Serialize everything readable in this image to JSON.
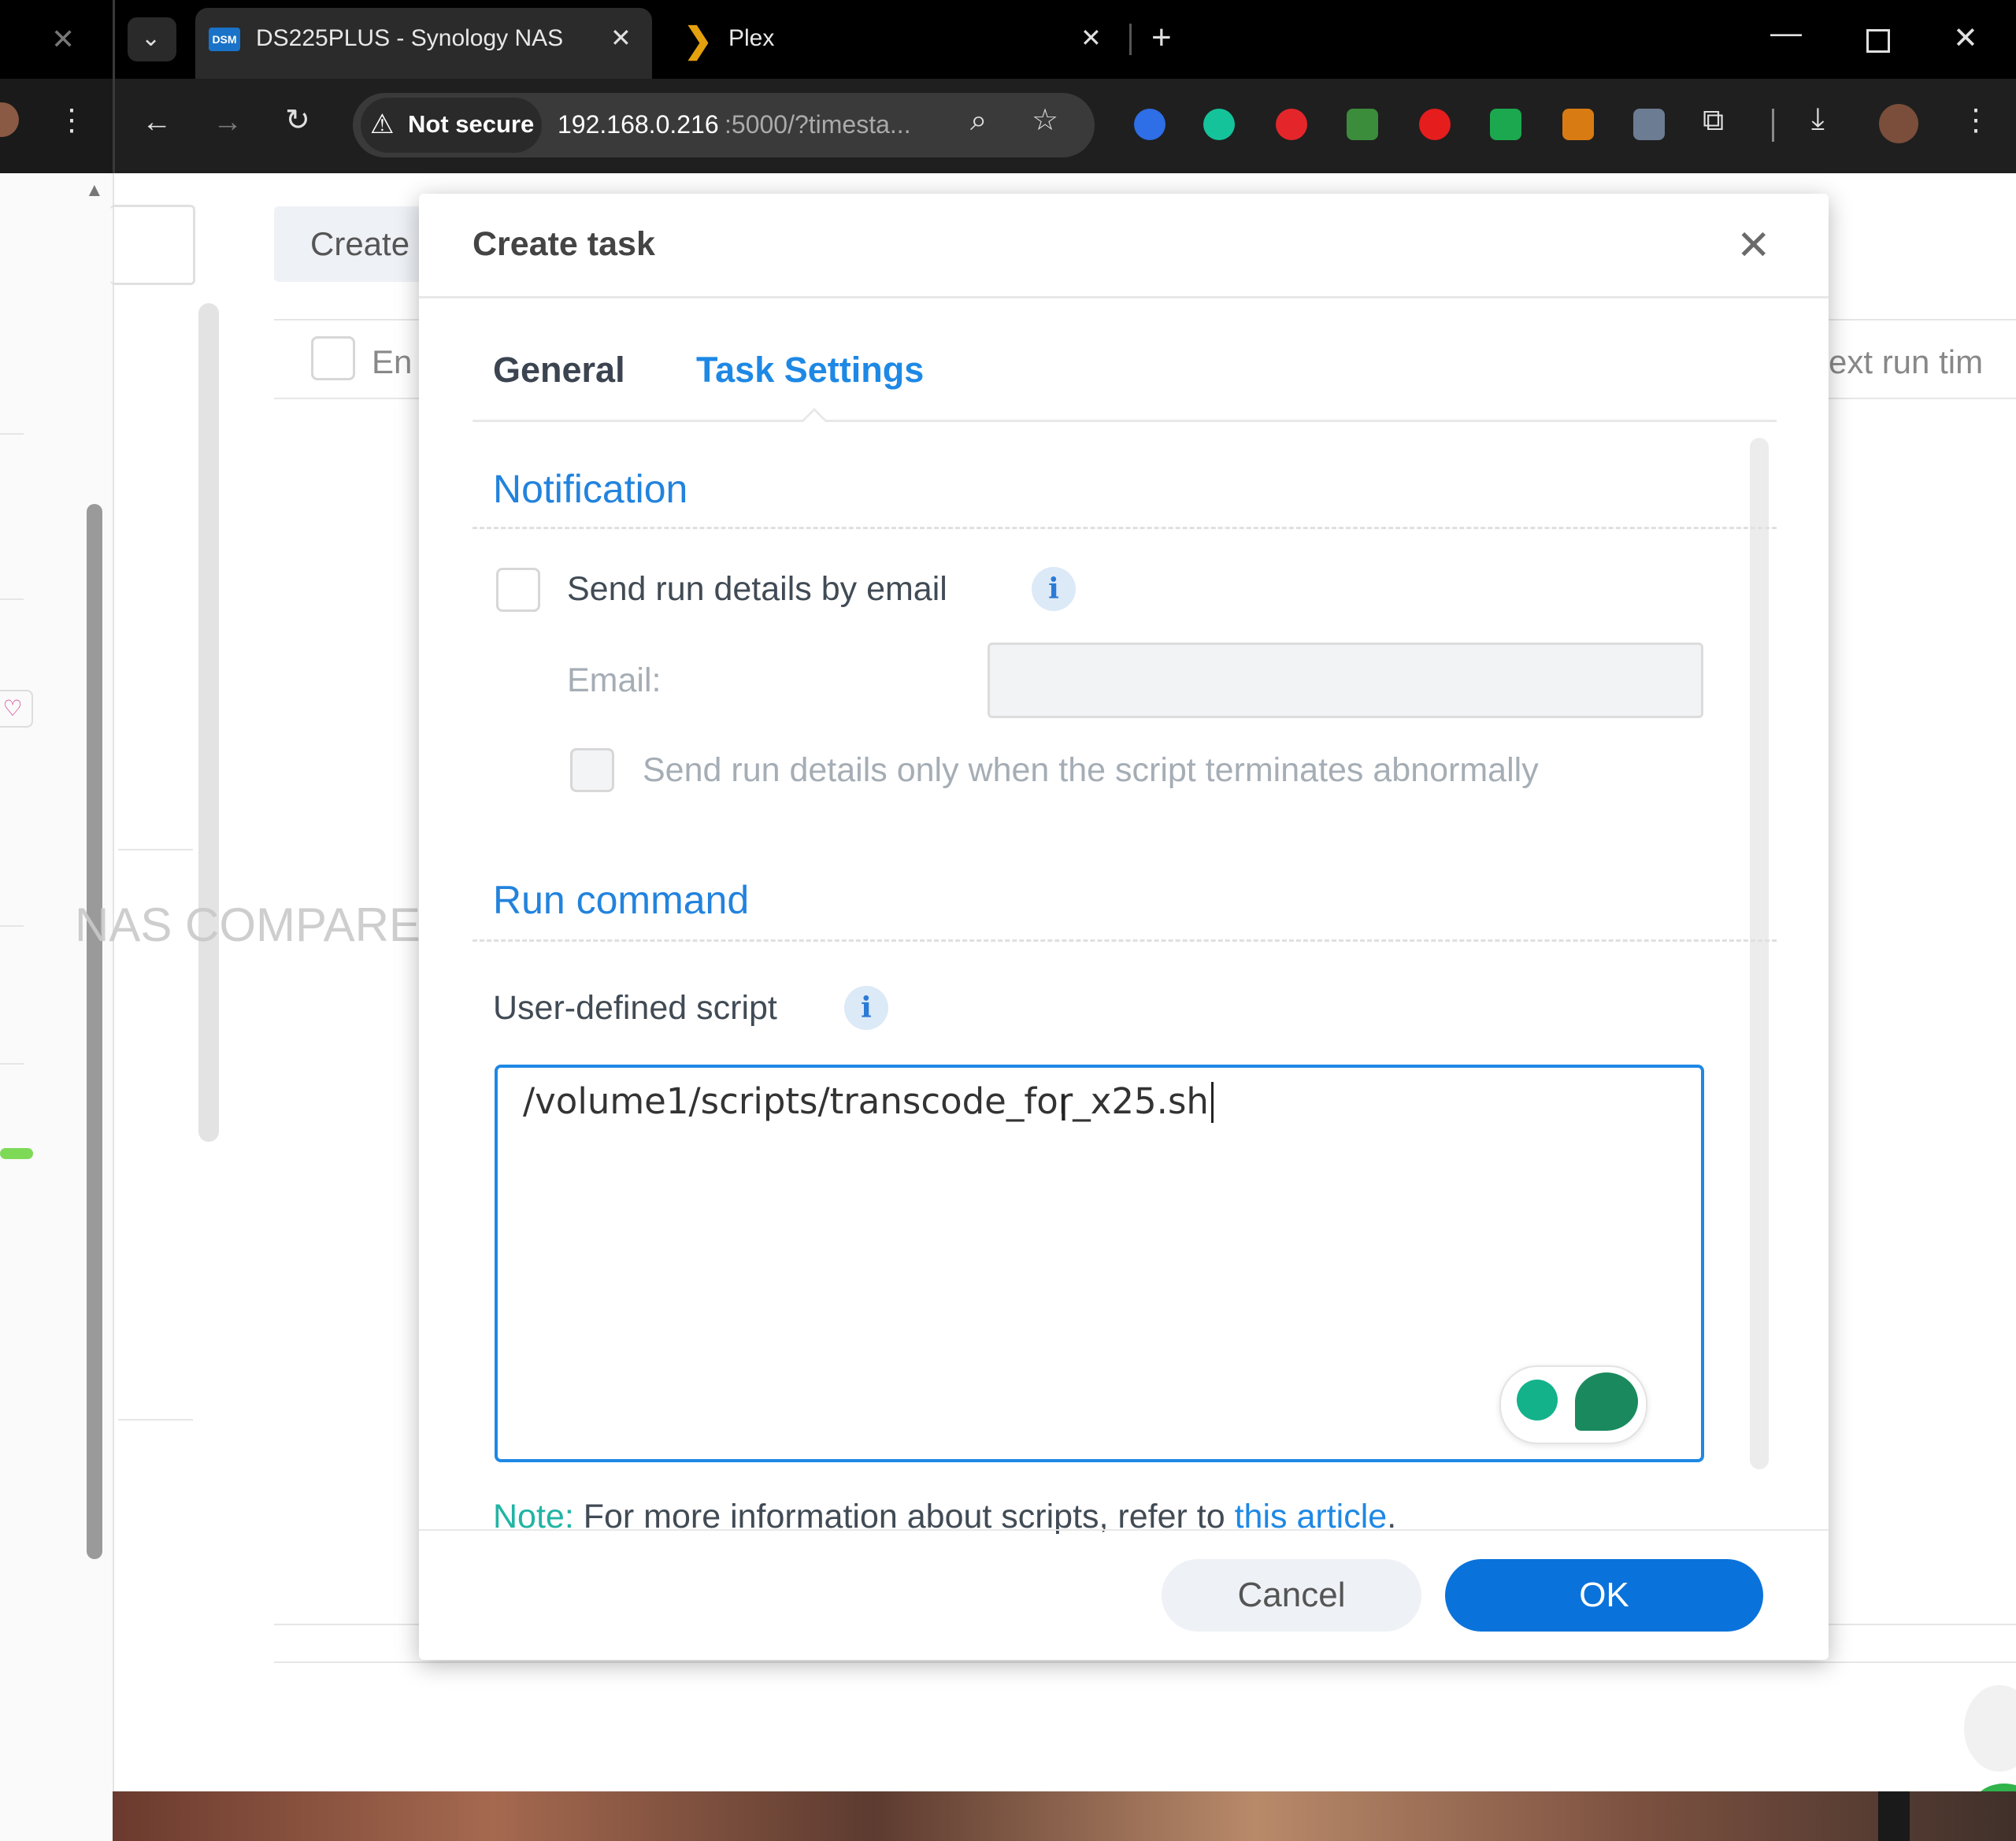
{
  "browser": {
    "tabs": [
      {
        "label": "DS225PLUS - Synology NAS",
        "favicon": "DSM",
        "active": true
      },
      {
        "label": "Plex",
        "favicon": "plex-chevron",
        "active": false
      }
    ],
    "address": {
      "security_label": "Not secure",
      "url_host": "192.168.0.216",
      "url_rest": ":5000/?timesta..."
    }
  },
  "background": {
    "create_button": "Create",
    "enable_column": "En",
    "next_run_column": "ext run tim",
    "watermark": "NAS COMPARES"
  },
  "dialog": {
    "title": "Create task",
    "tabs": [
      {
        "label": "General",
        "active": false
      },
      {
        "label": "Task Settings",
        "active": true
      }
    ],
    "notification": {
      "heading": "Notification",
      "send_email_label": "Send run details by email",
      "email_label": "Email:",
      "email_value": "",
      "abnormal_label": "Send run details only when the script terminates abnormally"
    },
    "run_command": {
      "heading": "Run command",
      "script_label": "User-defined script",
      "script_value": "/volume1/scripts/transcode_for_x25.sh"
    },
    "note": {
      "prefix": "Note:",
      "text": " For more information about scripts, refer to ",
      "link": "this article",
      "suffix": "."
    },
    "buttons": {
      "cancel": "Cancel",
      "ok": "OK"
    }
  },
  "colors": {
    "accent": "#1e88e5",
    "ok_button": "#0a73db",
    "note_prefix": "#21b4a4"
  }
}
